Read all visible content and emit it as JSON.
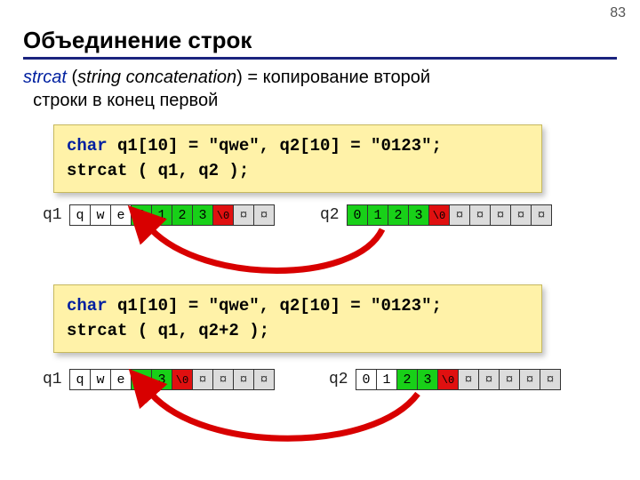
{
  "page_number": "83",
  "title": "Объединение строк",
  "intro": {
    "kw": "strcat",
    "paren1": "(",
    "em": "string concatenation",
    "paren2": ")",
    "eq": " = копирование второй",
    "line2": "строки в конец первой"
  },
  "code1": {
    "l1a": "char",
    "l1b": " q1[10] = \"qwe\", q2[10] = \"0123\";",
    "l2": "strcat ( q1, q2 );"
  },
  "code2": {
    "l1a": "char",
    "l1b": " q1[10] = \"qwe\", q2[10] = \"0123\";",
    "l2": "strcat ( q1, q2+2 );"
  },
  "labels": {
    "q1": "q1",
    "q2": "q2"
  },
  "arr_a_q1": [
    "q",
    "w",
    "e",
    "0",
    "1",
    "2",
    "3",
    "\\0",
    "¤",
    "¤"
  ],
  "arr_a_q2": [
    "0",
    "1",
    "2",
    "3",
    "\\0",
    "¤",
    "¤",
    "¤",
    "¤",
    "¤"
  ],
  "arr_b_q1": [
    "q",
    "w",
    "e",
    "2",
    "3",
    "\\0",
    "¤",
    "¤",
    "¤",
    "¤"
  ],
  "arr_b_q2": [
    "0",
    "1",
    "2",
    "3",
    "\\0",
    "¤",
    "¤",
    "¤",
    "¤",
    "¤"
  ],
  "colors": {
    "a_q1": [
      "",
      "",
      "",
      "green",
      "green",
      "green",
      "green",
      "red",
      "gray",
      "gray"
    ],
    "a_q2": [
      "green",
      "green",
      "green",
      "green",
      "red",
      "gray",
      "gray",
      "gray",
      "gray",
      "gray"
    ],
    "b_q1": [
      "",
      "",
      "",
      "green",
      "green",
      "red",
      "gray",
      "gray",
      "gray",
      "gray"
    ],
    "b_q2": [
      "",
      "",
      "green",
      "green",
      "red",
      "gray",
      "gray",
      "gray",
      "gray",
      "gray"
    ]
  },
  "chart_data": {
    "type": "table",
    "description": "Two strcat examples on 10-byte char arrays",
    "examples": [
      {
        "call": "strcat(q1, q2)",
        "q1_before": "qwe",
        "q2": "0123",
        "q1_after_bytes": [
          "q",
          "w",
          "e",
          "0",
          "1",
          "2",
          "3",
          "\\0",
          "¤",
          "¤"
        ],
        "q2_bytes": [
          "0",
          "1",
          "2",
          "3",
          "\\0",
          "¤",
          "¤",
          "¤",
          "¤",
          "¤"
        ]
      },
      {
        "call": "strcat(q1, q2+2)",
        "q1_before": "qwe",
        "q2_plus2": "23",
        "q1_after_bytes": [
          "q",
          "w",
          "e",
          "2",
          "3",
          "\\0",
          "¤",
          "¤",
          "¤",
          "¤"
        ],
        "q2_bytes": [
          "0",
          "1",
          "2",
          "3",
          "\\0",
          "¤",
          "¤",
          "¤",
          "¤",
          "¤"
        ]
      }
    ]
  }
}
